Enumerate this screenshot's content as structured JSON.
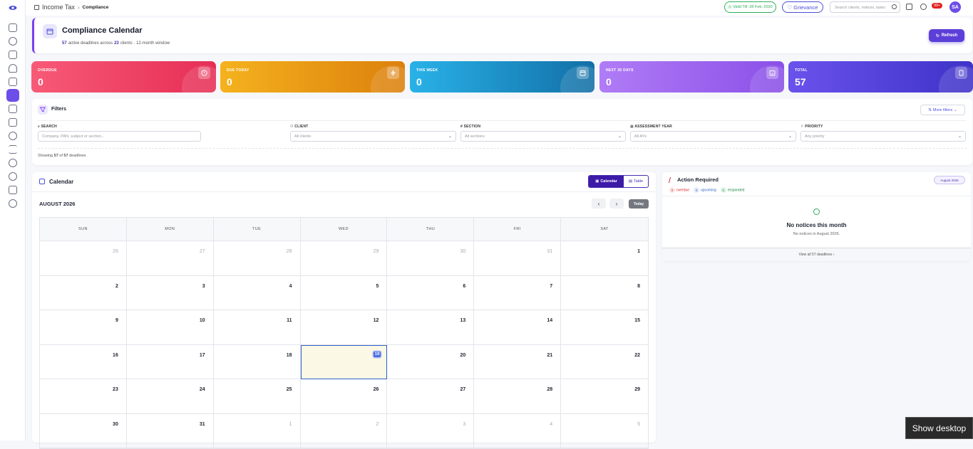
{
  "breadcrumb": {
    "root": "Income Tax",
    "current": "Compliance"
  },
  "topbar": {
    "valid_label": "Valid Till :28 Feb, 2030",
    "grievance_label": "Grievance",
    "search_placeholder": "Search clients, notices, tasks",
    "notif_badge": "99+",
    "avatar_initials": "SA"
  },
  "header": {
    "title": "Compliance Calendar",
    "active_count": "57",
    "active_text": "active deadlines across",
    "clients_count": "23",
    "clients_text": "clients · 12-month window",
    "refresh_label": "Refresh"
  },
  "stats": [
    {
      "label": "OVERDUE",
      "value": "0",
      "color": "#ee4766"
    },
    {
      "label": "DUE TODAY",
      "value": "0",
      "color": "#e69412"
    },
    {
      "label": "THIS WEEK",
      "value": "0",
      "color": "#1b8ec6"
    },
    {
      "label": "NEXT 30 DAYS",
      "value": "0",
      "color": "#9a62f0"
    },
    {
      "label": "TOTAL",
      "value": "57",
      "color": "#5b44e0"
    }
  ],
  "filters": {
    "title": "Filters",
    "more_label": "More filters",
    "fields": [
      {
        "label": "SEARCH",
        "placeholder": "Company, PAN, subject or section..."
      },
      {
        "label": "CLIENT",
        "placeholder": "All clients"
      },
      {
        "label": "SECTION",
        "placeholder": "All sections"
      },
      {
        "label": "ASSESSMENT YEAR",
        "placeholder": "All AYs"
      },
      {
        "label": "PRIORITY",
        "placeholder": "Any priority"
      }
    ],
    "showing_prefix": "Showing",
    "showing_count": "57",
    "showing_of": "of",
    "showing_total": "57",
    "showing_suffix": "deadlines"
  },
  "calendar": {
    "title": "Calendar",
    "view_calendar": "Calendar",
    "view_table": "Table",
    "month_label": "AUGUST 2026",
    "prev": "‹",
    "next": "›",
    "today_label": "Today",
    "weekdays": [
      "SUN",
      "MON",
      "TUE",
      "WED",
      "THU",
      "FRI",
      "SAT"
    ],
    "days": [
      {
        "d": "26",
        "muted": true
      },
      {
        "d": "27",
        "muted": true
      },
      {
        "d": "28",
        "muted": true
      },
      {
        "d": "29",
        "muted": true
      },
      {
        "d": "30",
        "muted": true
      },
      {
        "d": "31",
        "muted": true
      },
      {
        "d": "1"
      },
      {
        "d": "2"
      },
      {
        "d": "3"
      },
      {
        "d": "4"
      },
      {
        "d": "5"
      },
      {
        "d": "6"
      },
      {
        "d": "7"
      },
      {
        "d": "8"
      },
      {
        "d": "9"
      },
      {
        "d": "10"
      },
      {
        "d": "11"
      },
      {
        "d": "12"
      },
      {
        "d": "13"
      },
      {
        "d": "14"
      },
      {
        "d": "15"
      },
      {
        "d": "16"
      },
      {
        "d": "17"
      },
      {
        "d": "18"
      },
      {
        "d": "19",
        "selected": true
      },
      {
        "d": "20"
      },
      {
        "d": "21"
      },
      {
        "d": "22"
      },
      {
        "d": "23"
      },
      {
        "d": "24"
      },
      {
        "d": "25"
      },
      {
        "d": "26"
      },
      {
        "d": "27"
      },
      {
        "d": "28"
      },
      {
        "d": "29"
      },
      {
        "d": "30"
      },
      {
        "d": "31"
      },
      {
        "d": "1",
        "muted": true
      },
      {
        "d": "2",
        "muted": true
      },
      {
        "d": "3",
        "muted": true
      },
      {
        "d": "4",
        "muted": true
      },
      {
        "d": "5",
        "muted": true
      }
    ]
  },
  "action": {
    "title": "Action Required",
    "month_badge": "August 2026",
    "overdue_count": "0",
    "overdue_label": "overdue",
    "upcoming_count": "0",
    "upcoming_label": "upcoming",
    "responded_count": "0",
    "responded_label": "responded",
    "empty_title": "No notices this month",
    "empty_sub": "No notices in August 2026.",
    "footer_link": "View all 57 deadlines ›"
  },
  "tooltip": "Show desktop"
}
